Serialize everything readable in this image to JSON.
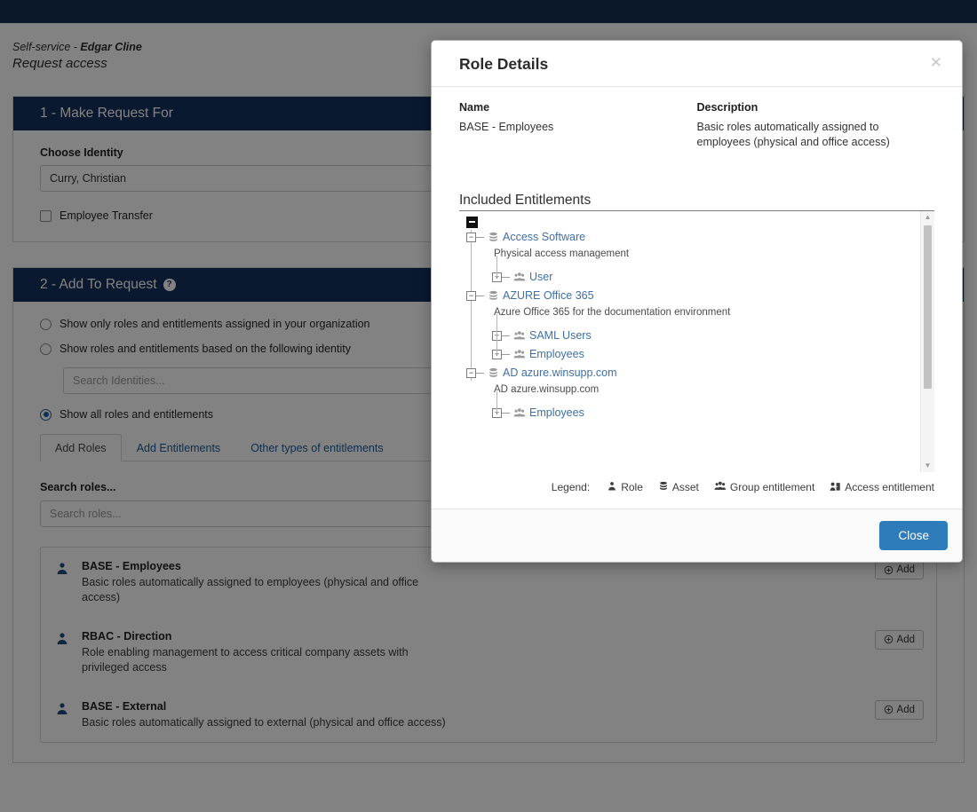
{
  "navbar": {
    "present": true
  },
  "background": {
    "breadcrumb": {
      "prefix": "Self-service - ",
      "user": "Edgar Cline"
    },
    "page_title": "Request access",
    "section1": {
      "header": "1 - Make Request For",
      "identity_label": "Choose Identity",
      "identity_value": "Curry, Christian",
      "employee_transfer_label": "Employee Transfer",
      "employee_transfer_checked": false
    },
    "section2": {
      "header": "2 - Add To Request",
      "help_icon": "help-circle-icon",
      "options": [
        {
          "label": "Show only roles and entitlements assigned in your organization",
          "selected": false
        },
        {
          "label": "Show roles and entitlements based on the following identity",
          "selected": false
        },
        {
          "label": "Show all roles and entitlements",
          "selected": true
        }
      ],
      "identity_search_placeholder": "Search Identities...",
      "tabs": [
        {
          "label": "Add Roles",
          "active": true
        },
        {
          "label": "Add Entitlements",
          "active": false
        },
        {
          "label": "Other types of entitlements",
          "active": false
        }
      ],
      "search_roles_label": "Search roles...",
      "search_roles_placeholder": "Search roles...",
      "roles": [
        {
          "name": "BASE - Employees",
          "description": "Basic roles automatically assigned to employees (physical and office access)",
          "add_label": "Add"
        },
        {
          "name": "RBAC - Direction",
          "description": "Role enabling management to access critical company assets with privileged access",
          "add_label": "Add"
        },
        {
          "name": "BASE - External",
          "description": "Basic roles automatically assigned to external (physical and office access)",
          "add_label": "Add"
        }
      ]
    }
  },
  "modal": {
    "title": "Role Details",
    "close_icon": "close-icon",
    "name_label": "Name",
    "name_value": "BASE - Employees",
    "description_label": "Description",
    "description_value": "Basic roles automatically assigned to employees (physical and office access)",
    "entitlements_title": "Included Entitlements",
    "tree": {
      "root_state": "expanded",
      "nodes": [
        {
          "label": "Access Software",
          "icon": "asset-icon",
          "state": "expanded",
          "description": "Physical access management",
          "children": [
            {
              "label": "User",
              "icon": "group-entitlement-icon",
              "state": "collapsed"
            }
          ]
        },
        {
          "label": "AZURE Office 365",
          "icon": "asset-icon",
          "state": "expanded",
          "description": "Azure Office 365 for the documentation environment",
          "children": [
            {
              "label": "SAML Users",
              "icon": "group-entitlement-icon",
              "state": "collapsed"
            },
            {
              "label": "Employees",
              "icon": "group-entitlement-icon",
              "state": "collapsed"
            }
          ]
        },
        {
          "label": "AD azure.winsupp.com",
          "icon": "asset-icon",
          "state": "expanded",
          "description": "AD azure.winsupp.com",
          "children": [
            {
              "label": "Employees",
              "icon": "group-entitlement-icon",
              "state": "collapsed"
            }
          ]
        }
      ]
    },
    "legend": {
      "title": "Legend:",
      "items": [
        {
          "label": "Role",
          "icon": "role-icon"
        },
        {
          "label": "Asset",
          "icon": "asset-icon"
        },
        {
          "label": "Group entitlement",
          "icon": "group-entitlement-icon"
        },
        {
          "label": "Access entitlement",
          "icon": "access-entitlement-icon"
        }
      ]
    },
    "close_button": "Close"
  },
  "colors": {
    "navbar": "#152f52",
    "panel_header": "#15325c",
    "primary_button": "#2e7cba",
    "link": "#1c5a9e",
    "tree_link": "#3f6fa5",
    "radio_selected": "#1d5fa8"
  }
}
